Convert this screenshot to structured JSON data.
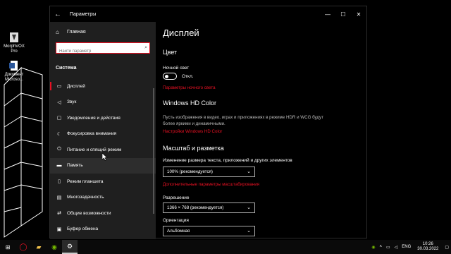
{
  "desktop": {
    "icons": [
      {
        "label": "MorphVOX Pro"
      },
      {
        "label": "Документ Microso..."
      }
    ]
  },
  "window": {
    "title": "Параметры",
    "back_icon": "arrow-left-icon",
    "controls": {
      "minimize": "minimize-icon",
      "maximize": "maximize-icon",
      "close": "close-icon"
    }
  },
  "nav": {
    "home_label": "Главная",
    "search_placeholder": "Найти параметр",
    "section_title": "Система",
    "items": [
      {
        "label": "Дисплей",
        "icon": "monitor-icon"
      },
      {
        "label": "Звук",
        "icon": "speaker-icon"
      },
      {
        "label": "Уведомления и действия",
        "icon": "notification-icon"
      },
      {
        "label": "Фокусировка внимания",
        "icon": "moon-icon"
      },
      {
        "label": "Питание и спящий режим",
        "icon": "power-icon"
      },
      {
        "label": "Память",
        "icon": "storage-icon"
      },
      {
        "label": "Режим планшета",
        "icon": "tablet-icon"
      },
      {
        "label": "Многозадачность",
        "icon": "multitask-icon"
      },
      {
        "label": "Общие возможности",
        "icon": "share-icon"
      },
      {
        "label": "Буфер обмена",
        "icon": "clipboard-icon"
      }
    ]
  },
  "content": {
    "page_title": "Дисплей",
    "color_heading": "Цвет",
    "night_light_label": "Ночной свет",
    "night_light_state": "Откл.",
    "night_light_link": "Параметры ночного света",
    "hdr_heading": "Windows HD Color",
    "hdr_desc": "Пусть изображения в видео, играх и приложениях в режиме HDR и WCG будут более яркими и динамичными.",
    "hdr_link": "Настройки Windows HD Color",
    "scale_heading": "Масштаб и разметка",
    "scale_label": "Изменение размера текста, приложений и других элементов",
    "scale_value": "100% (рекомендуется)",
    "scale_link": "Дополнительные параметры масштабирования",
    "resolution_label": "Разрешение",
    "resolution_value": "1366 × 768 (рекомендуется)",
    "orientation_label": "Ориентация",
    "orientation_value": "Альбомная"
  },
  "taskbar": {
    "language": "ENG",
    "time": "10:26",
    "date": "30.03.2022"
  },
  "colors": {
    "accent": "#e81123",
    "nav_bg": "#1f1f1f",
    "content_bg": "#000000"
  }
}
